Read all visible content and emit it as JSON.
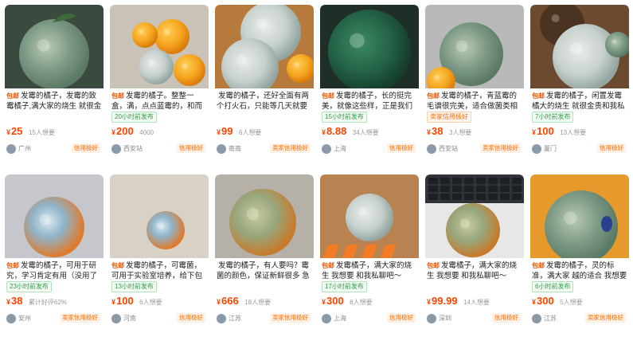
{
  "colors": {
    "price": "#ff4400",
    "badge": "#e8590c",
    "tag_orange": "#ff6a00",
    "tag_green": "#2f9e44"
  },
  "listings": [
    {
      "badge": "包邮",
      "title": "发霉的橘子，发霉的致霉橘子,满大家的烧生 就很金",
      "tag": "",
      "price_symbol": "¥",
      "price": "25",
      "want": "15人想要",
      "seller": "广州",
      "credit": "信用极好"
    },
    {
      "badge": "包邮",
      "title": "发霉的橘子。整整一盒，满，点点蓝霉的，和而个很差",
      "tag": "20小时前发布",
      "price_symbol": "¥",
      "price": "200",
      "want": "4000",
      "seller": "西安站",
      "credit": "信用极好"
    },
    {
      "badge": "",
      "title": "发霉的橘子，还好全面有两个打火石，只能等几天就要出来 ",
      "tag": "",
      "price_symbol": "¥",
      "price": "99",
      "want": "6人想要",
      "seller": "南南",
      "credit": "卖家信用极好"
    },
    {
      "badge": "包邮",
      "title": "发霉的橘子，长的挺完美，就像这些样，正是我们要们想要霉",
      "tag": "15小时前发布",
      "price_symbol": "¥",
      "price": "8.88",
      "want": "34人想要",
      "seller": "上海",
      "credit": "信用极好"
    },
    {
      "badge": "包邮",
      "title": "发霉的橘子，青蓝霉的毛谱很完美，适合做菌类相关的调查",
      "tag": "卖家信用极好",
      "price_symbol": "¥",
      "price": "38",
      "want": "3人想要",
      "seller": "西安站",
      "credit": "卖家信用极好"
    },
    {
      "badge": "包邮",
      "title": "发霉的橘子，闲置发霉 橘大的烧生 就很金贵和我私聊吧～",
      "tag": "7小时前发布",
      "price_symbol": "¥",
      "price": "100",
      "want": "13人想要",
      "seller": "厦门",
      "credit": "信用极好"
    },
    {
      "badge": "包邮",
      "title": "发霉的橘子，可用于研究，学习肯定有用（没用了～",
      "tag": "23小时前发布",
      "price_symbol": "¥",
      "price": "38",
      "want": "累计好评62%",
      "seller": "安州",
      "credit": "卖家信用极好"
    },
    {
      "badge": "包邮",
      "title": "发霉的橘子，可霉菌，可用于实验室培养，给下包邮 感",
      "tag": "13小时前发布",
      "price_symbol": "¥",
      "price": "100",
      "want": "6人想要",
      "seller": "河南",
      "credit": "信用极好"
    },
    {
      "badge": "",
      "title": "发霉的橘子，有人要吗？霉菌的颜色，保证新鲜很多 急卖了",
      "tag": "",
      "price_symbol": "¥",
      "price": "666",
      "want": "18人想要",
      "seller": "江苏",
      "credit": "卖家信用极好"
    },
    {
      "badge": "包邮",
      "title": "发霉橘子，满大家的烧生 我想要 和我私聊吧～",
      "tag": "17小时前发布",
      "price_symbol": "¥",
      "price": "300",
      "want": "8人想要",
      "seller": "上海",
      "credit": "信用极好"
    },
    {
      "badge": "包邮",
      "title": "发霉橘子，满大家的烧生 我想要 和我私聊吧～",
      "tag": "",
      "price_symbol": "¥",
      "price": "99.99",
      "want": "14人想要",
      "seller": "深圳",
      "credit": "信用极好"
    },
    {
      "badge": "包邮",
      "title": "发霉的橘子，灵的标准，满大家 越的适合 我想要和我私聊吧～",
      "tag": "6小时前发布",
      "price_symbol": "¥",
      "price": "300",
      "want": "5人想要",
      "seller": "江苏",
      "credit": "卖家信用极好"
    }
  ]
}
